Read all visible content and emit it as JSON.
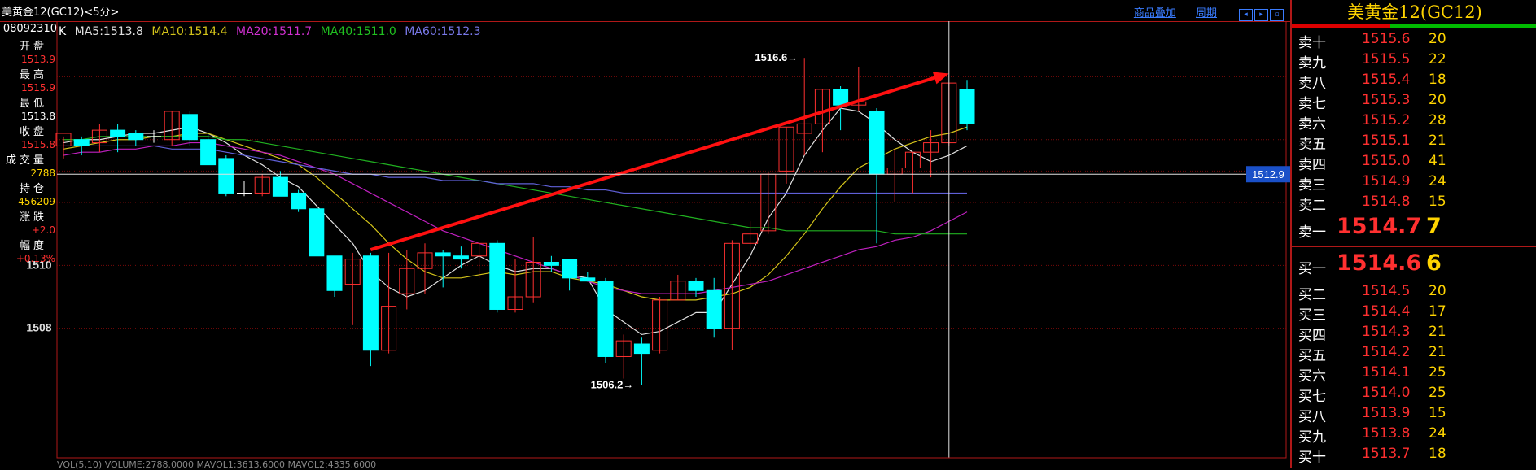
{
  "title": "美黄金12(GC12)<5分>",
  "toolbar": {
    "overlay_label": "商品叠加",
    "period_label": "周期"
  },
  "legend": {
    "k": "K",
    "ma5": "MA5:1513.8",
    "ma10": "MA10:1514.4",
    "ma20": "MA20:1511.7",
    "ma40": "MA40:1511.0",
    "ma60": "MA60:1512.3"
  },
  "left_panel": {
    "date": "08092310",
    "rows": [
      {
        "label": "开盘",
        "value": "1513.9",
        "color": "#ff3030"
      },
      {
        "label": "最高",
        "value": "1515.9",
        "color": "#ff3030"
      },
      {
        "label": "最低",
        "value": "1513.8",
        "color": "#ffffff"
      },
      {
        "label": "收盘",
        "value": "1515.8",
        "color": "#ff3030"
      },
      {
        "label": "成交量",
        "value": "2788",
        "color": "#ffd400"
      },
      {
        "label": "持仓",
        "value": "456209",
        "color": "#ffd400"
      },
      {
        "label": "涨跌",
        "value": "+2.0",
        "color": "#ff3030"
      },
      {
        "label": "幅度",
        "value": "+0.13%",
        "color": "#ff3030"
      }
    ]
  },
  "crosshair_value": "1512.9",
  "annotations": {
    "high": "1516.6→",
    "low": "1506.2→"
  },
  "bottom_line": "VOL(5,10) VOLUME:2788.0000 MAVOL1:3613.6000 MAVOL2:4335.6000",
  "chart_data": {
    "type": "candlestick",
    "title": "美黄金12(GC12)<5分>",
    "ylim": [
      1506.0,
      1517.2
    ],
    "yticks": [
      1508,
      1510
    ],
    "candles": [
      {
        "o": 1513.8,
        "h": 1514.1,
        "l": 1513.4,
        "c": 1514.2
      },
      {
        "o": 1514.0,
        "h": 1514.1,
        "l": 1513.5,
        "c": 1513.8
      },
      {
        "o": 1513.9,
        "h": 1514.5,
        "l": 1513.6,
        "c": 1514.3
      },
      {
        "o": 1514.3,
        "h": 1514.5,
        "l": 1513.6,
        "c": 1514.1
      },
      {
        "o": 1514.2,
        "h": 1514.3,
        "l": 1513.8,
        "c": 1514.0
      },
      {
        "o": 1514.1,
        "h": 1514.3,
        "l": 1513.9,
        "c": 1514.1
      },
      {
        "o": 1514.0,
        "h": 1514.9,
        "l": 1513.8,
        "c": 1514.9
      },
      {
        "o": 1514.8,
        "h": 1514.9,
        "l": 1513.8,
        "c": 1514.0
      },
      {
        "o": 1514.0,
        "h": 1514.2,
        "l": 1513.2,
        "c": 1513.2
      },
      {
        "o": 1513.4,
        "h": 1513.5,
        "l": 1512.2,
        "c": 1512.3
      },
      {
        "o": 1512.3,
        "h": 1512.7,
        "l": 1512.2,
        "c": 1512.3
      },
      {
        "o": 1512.3,
        "h": 1512.9,
        "l": 1512.2,
        "c": 1512.8
      },
      {
        "o": 1512.8,
        "h": 1513.0,
        "l": 1512.2,
        "c": 1512.2
      },
      {
        "o": 1512.3,
        "h": 1512.4,
        "l": 1511.7,
        "c": 1511.8
      },
      {
        "o": 1511.8,
        "h": 1511.8,
        "l": 1510.3,
        "c": 1510.3
      },
      {
        "o": 1510.3,
        "h": 1510.3,
        "l": 1509.0,
        "c": 1509.2
      },
      {
        "o": 1509.4,
        "h": 1510.4,
        "l": 1508.1,
        "c": 1510.2
      },
      {
        "o": 1510.3,
        "h": 1510.4,
        "l": 1506.8,
        "c": 1507.3
      },
      {
        "o": 1507.3,
        "h": 1510.4,
        "l": 1507.2,
        "c": 1508.7
      },
      {
        "o": 1509.1,
        "h": 1510.5,
        "l": 1508.6,
        "c": 1509.9
      },
      {
        "o": 1509.9,
        "h": 1510.7,
        "l": 1509.1,
        "c": 1510.4
      },
      {
        "o": 1510.4,
        "h": 1510.5,
        "l": 1509.3,
        "c": 1510.3
      },
      {
        "o": 1510.3,
        "h": 1510.6,
        "l": 1509.9,
        "c": 1510.2
      },
      {
        "o": 1510.3,
        "h": 1510.7,
        "l": 1509.6,
        "c": 1510.7
      },
      {
        "o": 1510.7,
        "h": 1510.8,
        "l": 1508.5,
        "c": 1508.6
      },
      {
        "o": 1508.6,
        "h": 1510.2,
        "l": 1508.5,
        "c": 1509.0
      },
      {
        "o": 1509.0,
        "h": 1510.9,
        "l": 1508.8,
        "c": 1510.1
      },
      {
        "o": 1510.1,
        "h": 1510.3,
        "l": 1509.8,
        "c": 1510.0
      },
      {
        "o": 1510.2,
        "h": 1510.2,
        "l": 1509.2,
        "c": 1509.6
      },
      {
        "o": 1509.6,
        "h": 1509.8,
        "l": 1509.5,
        "c": 1509.5
      },
      {
        "o": 1509.5,
        "h": 1509.6,
        "l": 1506.9,
        "c": 1507.1
      },
      {
        "o": 1507.1,
        "h": 1507.8,
        "l": 1506.4,
        "c": 1507.6
      },
      {
        "o": 1507.5,
        "h": 1507.7,
        "l": 1506.2,
        "c": 1507.2
      },
      {
        "o": 1507.3,
        "h": 1509.0,
        "l": 1507.2,
        "c": 1508.9
      },
      {
        "o": 1508.9,
        "h": 1509.7,
        "l": 1508.9,
        "c": 1509.5
      },
      {
        "o": 1509.5,
        "h": 1509.6,
        "l": 1509.0,
        "c": 1509.2
      },
      {
        "o": 1509.2,
        "h": 1509.6,
        "l": 1507.7,
        "c": 1508.0
      },
      {
        "o": 1508.0,
        "h": 1510.8,
        "l": 1507.3,
        "c": 1510.7
      },
      {
        "o": 1510.7,
        "h": 1511.4,
        "l": 1510.5,
        "c": 1511.0
      },
      {
        "o": 1511.1,
        "h": 1513.0,
        "l": 1511.0,
        "c": 1512.9
      },
      {
        "o": 1513.0,
        "h": 1514.4,
        "l": 1512.6,
        "c": 1514.4
      },
      {
        "o": 1514.2,
        "h": 1516.6,
        "l": 1513.5,
        "c": 1514.5
      },
      {
        "o": 1514.5,
        "h": 1515.6,
        "l": 1513.6,
        "c": 1515.6
      },
      {
        "o": 1515.6,
        "h": 1515.7,
        "l": 1514.3,
        "c": 1515.1
      },
      {
        "o": 1515.1,
        "h": 1516.3,
        "l": 1514.9,
        "c": 1515.2
      },
      {
        "o": 1514.9,
        "h": 1515.0,
        "l": 1510.7,
        "c": 1512.9
      },
      {
        "o": 1512.9,
        "h": 1513.7,
        "l": 1512.0,
        "c": 1513.1
      },
      {
        "o": 1513.1,
        "h": 1513.6,
        "l": 1512.3,
        "c": 1513.6
      },
      {
        "o": 1513.6,
        "h": 1514.3,
        "l": 1512.8,
        "c": 1513.9
      },
      {
        "o": 1513.9,
        "h": 1515.8,
        "l": 1513.8,
        "c": 1515.8
      },
      {
        "o": 1515.6,
        "h": 1515.9,
        "l": 1514.3,
        "c": 1514.5
      }
    ],
    "series": [
      {
        "name": "MA5",
        "color": "#e0e0e0",
        "values": [
          1513.9,
          1514.0,
          1514.0,
          1514.1,
          1514.2,
          1514.2,
          1514.3,
          1514.4,
          1514.2,
          1513.9,
          1513.5,
          1513.2,
          1512.8,
          1512.5,
          1511.9,
          1511.3,
          1510.7,
          1509.8,
          1509.3,
          1509.0,
          1509.2,
          1509.6,
          1510.0,
          1510.3,
          1510.0,
          1509.8,
          1509.9,
          1509.9,
          1509.7,
          1509.6,
          1508.6,
          1508.2,
          1507.8,
          1507.9,
          1508.2,
          1508.5,
          1508.5,
          1509.4,
          1510.3,
          1511.5,
          1512.3,
          1513.5,
          1514.3,
          1515.0,
          1514.9,
          1514.5,
          1514.0,
          1513.6,
          1513.3,
          1513.5,
          1513.8
        ]
      },
      {
        "name": "MA10",
        "color": "#d4c41a",
        "values": [
          1513.7,
          1513.8,
          1513.9,
          1514.0,
          1514.0,
          1514.1,
          1514.1,
          1514.2,
          1514.2,
          1514.0,
          1513.8,
          1513.6,
          1513.4,
          1513.2,
          1512.8,
          1512.3,
          1511.8,
          1511.3,
          1510.7,
          1510.2,
          1509.8,
          1509.6,
          1509.6,
          1509.7,
          1509.8,
          1509.7,
          1509.8,
          1509.8,
          1509.6,
          1509.5,
          1509.4,
          1509.2,
          1509.0,
          1508.9,
          1508.9,
          1508.9,
          1509.0,
          1509.1,
          1509.3,
          1509.7,
          1510.3,
          1511.0,
          1511.8,
          1512.5,
          1513.1,
          1513.4,
          1513.7,
          1513.9,
          1514.1,
          1514.2,
          1514.4
        ]
      },
      {
        "name": "MA20",
        "color": "#c020c0",
        "values": [
          1513.5,
          1513.6,
          1513.6,
          1513.7,
          1513.7,
          1513.8,
          1513.8,
          1513.9,
          1513.9,
          1513.8,
          1513.7,
          1513.6,
          1513.5,
          1513.3,
          1513.1,
          1512.9,
          1512.6,
          1512.3,
          1512.0,
          1511.7,
          1511.4,
          1511.1,
          1510.9,
          1510.7,
          1510.5,
          1510.3,
          1510.1,
          1509.9,
          1509.7,
          1509.5,
          1509.3,
          1509.2,
          1509.1,
          1509.1,
          1509.1,
          1509.1,
          1509.2,
          1509.3,
          1509.4,
          1509.5,
          1509.7,
          1509.9,
          1510.1,
          1510.3,
          1510.5,
          1510.6,
          1510.8,
          1510.9,
          1511.1,
          1511.4,
          1511.7
        ]
      },
      {
        "name": "MA40",
        "color": "#20b020",
        "values": [
          1514.0,
          1514.0,
          1514.1,
          1514.1,
          1514.1,
          1514.1,
          1514.1,
          1514.1,
          1514.1,
          1514.0,
          1514.0,
          1513.9,
          1513.8,
          1513.7,
          1513.6,
          1513.5,
          1513.4,
          1513.3,
          1513.2,
          1513.1,
          1513.0,
          1512.9,
          1512.8,
          1512.7,
          1512.6,
          1512.5,
          1512.4,
          1512.3,
          1512.2,
          1512.1,
          1512.0,
          1511.9,
          1511.8,
          1511.7,
          1511.6,
          1511.5,
          1511.4,
          1511.3,
          1511.2,
          1511.2,
          1511.1,
          1511.1,
          1511.1,
          1511.1,
          1511.1,
          1511.1,
          1511.0,
          1511.0,
          1511.0,
          1511.0,
          1511.0
        ]
      },
      {
        "name": "MA60",
        "color": "#6060d8",
        "values": [
          1513.8,
          1513.8,
          1513.8,
          1513.8,
          1513.8,
          1513.8,
          1513.7,
          1513.7,
          1513.7,
          1513.6,
          1513.5,
          1513.4,
          1513.3,
          1513.2,
          1513.1,
          1513.0,
          1512.9,
          1512.9,
          1512.8,
          1512.8,
          1512.8,
          1512.7,
          1512.7,
          1512.7,
          1512.6,
          1512.6,
          1512.6,
          1512.5,
          1512.5,
          1512.4,
          1512.4,
          1512.3,
          1512.3,
          1512.3,
          1512.3,
          1512.3,
          1512.3,
          1512.3,
          1512.3,
          1512.3,
          1512.3,
          1512.3,
          1512.3,
          1512.3,
          1512.3,
          1512.3,
          1512.3,
          1512.3,
          1512.3,
          1512.3,
          1512.3
        ]
      }
    ],
    "trend_arrow": {
      "from_index": 17,
      "from_value": 1510.5,
      "to_index": 49,
      "to_value": 1516.1
    },
    "crosshair": {
      "index": 49,
      "value": 1512.9
    }
  },
  "orderbook": {
    "title": "美黄金12(GC12)",
    "asks": [
      {
        "label": "卖十",
        "price": "1515.6",
        "vol": "20"
      },
      {
        "label": "卖九",
        "price": "1515.5",
        "vol": "22"
      },
      {
        "label": "卖八",
        "price": "1515.4",
        "vol": "18"
      },
      {
        "label": "卖七",
        "price": "1515.3",
        "vol": "20"
      },
      {
        "label": "卖六",
        "price": "1515.2",
        "vol": "28"
      },
      {
        "label": "卖五",
        "price": "1515.1",
        "vol": "21"
      },
      {
        "label": "卖四",
        "price": "1515.0",
        "vol": "41"
      },
      {
        "label": "卖三",
        "price": "1514.9",
        "vol": "24"
      },
      {
        "label": "卖二",
        "price": "1514.8",
        "vol": "15"
      }
    ],
    "ask1": {
      "label": "卖一",
      "price": "1514.7",
      "vol": "7"
    },
    "bid1": {
      "label": "买一",
      "price": "1514.6",
      "vol": "6"
    },
    "bids": [
      {
        "label": "买二",
        "price": "1514.5",
        "vol": "20"
      },
      {
        "label": "买三",
        "price": "1514.4",
        "vol": "17"
      },
      {
        "label": "买四",
        "price": "1514.3",
        "vol": "21"
      },
      {
        "label": "买五",
        "price": "1514.2",
        "vol": "21"
      },
      {
        "label": "买六",
        "price": "1514.1",
        "vol": "25"
      },
      {
        "label": "买七",
        "price": "1514.0",
        "vol": "25"
      },
      {
        "label": "买八",
        "price": "1513.9",
        "vol": "15"
      },
      {
        "label": "买九",
        "price": "1513.8",
        "vol": "24"
      },
      {
        "label": "买十",
        "price": "1513.7",
        "vol": "18"
      }
    ]
  }
}
